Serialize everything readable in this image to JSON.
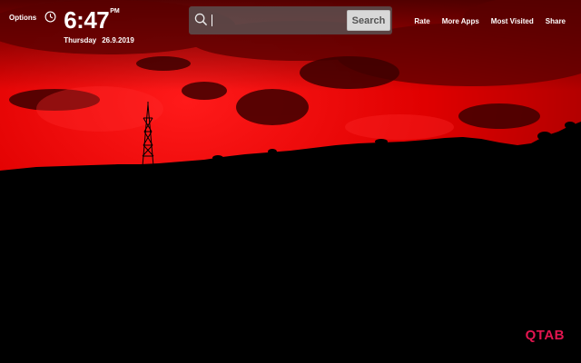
{
  "header": {
    "options_label": "Options",
    "time": "6:47",
    "ampm": "PM",
    "day": "Thursday",
    "date": "26.9.2019"
  },
  "search": {
    "value": "",
    "placeholder": "",
    "button_label": "Search"
  },
  "nav": {
    "items": [
      "Rate",
      "More Apps",
      "Most Visited",
      "Share"
    ]
  },
  "brand": {
    "logo_text": "QTAB",
    "color": "#e3154f"
  },
  "icons": {
    "clock": "clock-icon",
    "search": "search-icon"
  },
  "colors": {
    "sky": "#e60000",
    "silhouette": "#000000"
  }
}
